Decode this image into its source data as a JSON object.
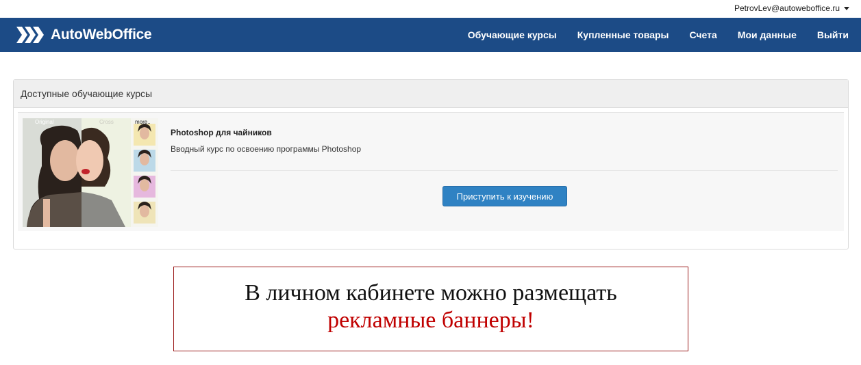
{
  "user": {
    "email": "PetrovLev@autoweboffice.ru"
  },
  "brand": {
    "name": "AutoWebOffice",
    "color": "#1c4b86"
  },
  "nav": {
    "items": [
      {
        "label": "Обучающие курсы"
      },
      {
        "label": "Купленные товары"
      },
      {
        "label": "Счета"
      },
      {
        "label": "Мои данные"
      },
      {
        "label": "Выйти"
      }
    ]
  },
  "panel": {
    "heading": "Доступные обучающие курсы",
    "course": {
      "thumb_captions": [
        "Original",
        "Cross",
        "more.."
      ],
      "title": "Photoshop для чайников",
      "description": "Вводный курс по освоению программы Photoshop",
      "button_label": "Приступить к изучению"
    }
  },
  "banner": {
    "line1": "В личном кабинете можно размещать",
    "line2": "рекламные баннеры!"
  }
}
